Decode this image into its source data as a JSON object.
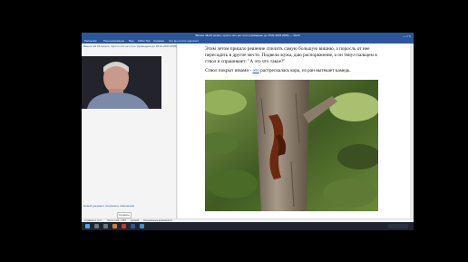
{
  "window": {
    "title": "Вишня ЧЕ 06 ничего, просто сил нет пото (проведено до 18.01.2023 2006) — Word"
  },
  "ribbon": {
    "tabs": [
      "Рассылки",
      "Рецензирование",
      "Вид",
      "Office Tab",
      "Справка",
      "Что вы хотите сделать?"
    ]
  },
  "nav": {
    "title": "Вишня ЧЕ 06 ничего, просто сил нет пото (проведено до 18.01.2023 2006)"
  },
  "document": {
    "para1": "Этим летом пришло решение спилить самую большую вишню, а поросль от нее пересадить в другое место. Подвели мужа, даю распоряжение, а он тянул пальцем в ствол и спрашивает: \"А это что такое?\"",
    "para2_before": "Ствол покрыт язвами - ",
    "para2_link": "это",
    "para2_after": " растрескалась кора, из ран вытекает камедь."
  },
  "notification": "Новый документ (сохранить изменения)",
  "comment_button": "Создать",
  "statusbar": {
    "page": "Страница 1 из 3",
    "words": "Число слов: 1 867",
    "lang": "русский",
    "access": "Специальные возможности"
  },
  "colors": {
    "accent": "#2b579a",
    "bark": "#8a7a6a",
    "resin": "#6b2a10",
    "foliage": "#4d6e2a"
  }
}
